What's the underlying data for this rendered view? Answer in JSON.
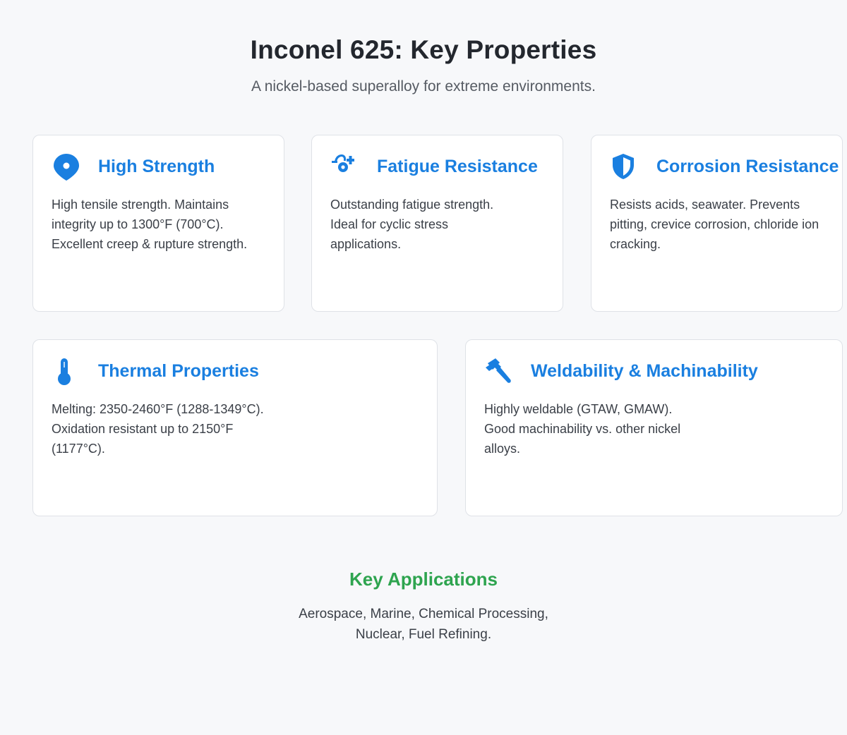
{
  "header": {
    "title": "Inconel 625: Key Properties",
    "subtitle": "A nickel-based superalloy for extreme environments."
  },
  "cards": [
    {
      "icon": "map-pin-icon",
      "title": "High Strength",
      "text": "High tensile strength. Maintains integrity up to 1300°F (700°C). Excellent creep & rupture strength."
    },
    {
      "icon": "cyclic-stress-icon",
      "title": "Fatigue Resistance",
      "text": "Outstanding fatigue strength. Ideal for cyclic stress applications."
    },
    {
      "icon": "shield-icon",
      "title": "Corrosion Resistance",
      "text": "Resists acids, seawater. Prevents pitting, crevice corrosion, chloride ion cracking."
    },
    {
      "icon": "thermometer-icon",
      "title": "Thermal Properties",
      "text": "Melting: 2350-2460°F (1288-1349°C). Oxidation resistant up to 2150°F (1177°C)."
    },
    {
      "icon": "hammer-icon",
      "title": "Weldability & Machinability",
      "text": "Highly weldable (GTAW, GMAW). Good machinability vs. other nickel alloys."
    }
  ],
  "applications": {
    "title": "Key Applications",
    "text": "Aerospace, Marine, Chemical Processing, Nuclear, Fuel Refining."
  },
  "colors": {
    "accent_blue": "#1a7fe0",
    "accent_green": "#2ea44f",
    "background": "#f7f8fa"
  }
}
